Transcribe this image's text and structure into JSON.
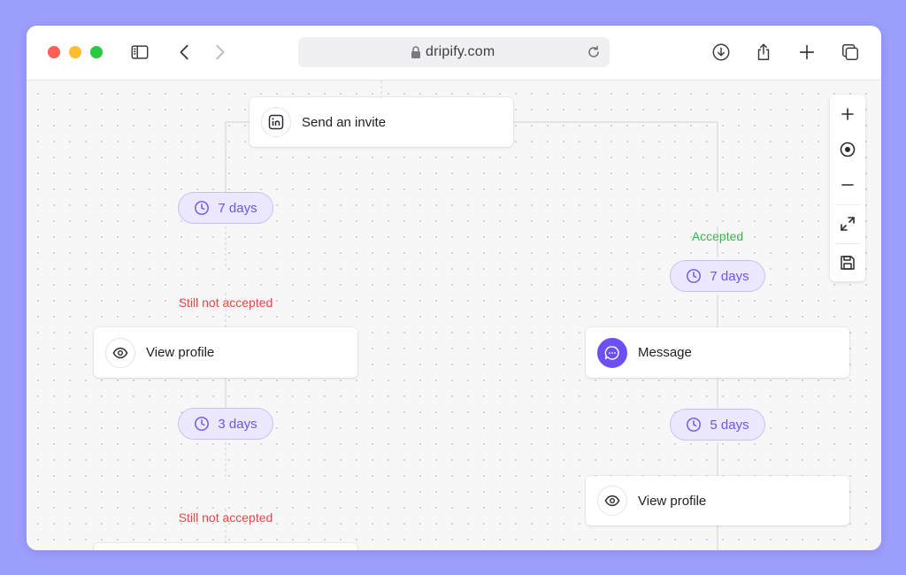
{
  "browser": {
    "url": "dripify.com",
    "icons": [
      "sidebar-icon",
      "back-icon",
      "forward-icon",
      "lock-icon",
      "reload-icon",
      "download-icon",
      "share-icon",
      "new-tab-icon",
      "tabs-overview-icon"
    ]
  },
  "flow": {
    "root": {
      "label": "Send an invite",
      "icon": "linkedin-icon"
    },
    "left_branch": {
      "delay1": "7 days",
      "condition1": "Still not accepted",
      "step1": {
        "label": "View profile",
        "icon": "eye-icon"
      },
      "delay2": "3 days",
      "condition2": "Still not accepted"
    },
    "right_branch": {
      "condition": "Accepted",
      "delay1": "7 days",
      "step1": {
        "label": "Message",
        "icon": "message-icon"
      },
      "delay2": "5 days",
      "step2": {
        "label": "View profile",
        "icon": "eye-icon"
      }
    }
  },
  "zoom_controls": [
    "zoom-in-icon",
    "recenter-icon",
    "zoom-out-icon",
    "fit-screen-icon",
    "save-icon"
  ],
  "colors": {
    "background": "#9c9efb",
    "accent": "#6c4ff5",
    "pill_bg": "#ebe8ff",
    "negative": "#ef4444",
    "positive": "#3db54a"
  }
}
